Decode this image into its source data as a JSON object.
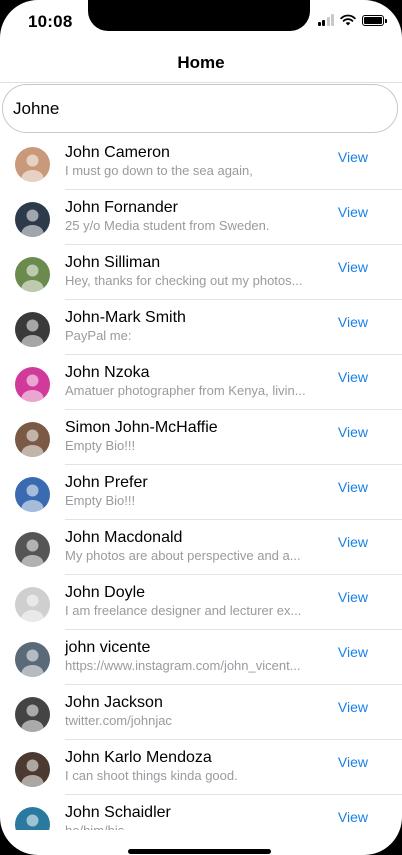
{
  "status_bar": {
    "time": "10:08"
  },
  "nav": {
    "title": "Home"
  },
  "search": {
    "value": "Johne",
    "placeholder": ""
  },
  "accent_color": "#1a7fe6",
  "users": [
    {
      "name": "John Cameron",
      "bio": "I must go down to the sea again,",
      "action": "View",
      "avatar_color": "#c89a7a"
    },
    {
      "name": "John Fornander",
      "bio": "25 y/o Media student from Sweden.",
      "action": "View",
      "avatar_color": "#2d3a4a"
    },
    {
      "name": "John Silliman",
      "bio": "Hey, thanks for checking out my photos...",
      "action": "View",
      "avatar_color": "#6b8a4e"
    },
    {
      "name": "John-Mark Smith",
      "bio": "PayPal me:",
      "action": "View",
      "avatar_color": "#3a3a3a"
    },
    {
      "name": "John Nzoka",
      "bio": "Amatuer photographer from Kenya, livin...",
      "action": "View",
      "avatar_color": "#d13a9a"
    },
    {
      "name": "Simon John-McHaffie",
      "bio": "Empty Bio!!!",
      "action": "View",
      "avatar_color": "#7a5a44"
    },
    {
      "name": "John Prefer",
      "bio": "Empty Bio!!!",
      "action": "View",
      "avatar_color": "#3a6ab0"
    },
    {
      "name": "John Macdonald",
      "bio": "My photos are about perspective and a...",
      "action": "View",
      "avatar_color": "#555555"
    },
    {
      "name": "John Doyle",
      "bio": "I am freelance designer and lecturer ex...",
      "action": "View",
      "avatar_color": "#cfcfcf"
    },
    {
      "name": "john vicente",
      "bio": "https://www.instagram.com/john_vicent...",
      "action": "View",
      "avatar_color": "#5a6a78"
    },
    {
      "name": "John Jackson",
      "bio": "twitter.com/johnjac",
      "action": "View",
      "avatar_color": "#444444"
    },
    {
      "name": "John Karlo Mendoza",
      "bio": "I can shoot things kinda good.",
      "action": "View",
      "avatar_color": "#4a3a30"
    },
    {
      "name": "John Schaidler",
      "bio": "he/him/his",
      "action": "View",
      "avatar_color": "#2a7aa0"
    }
  ]
}
